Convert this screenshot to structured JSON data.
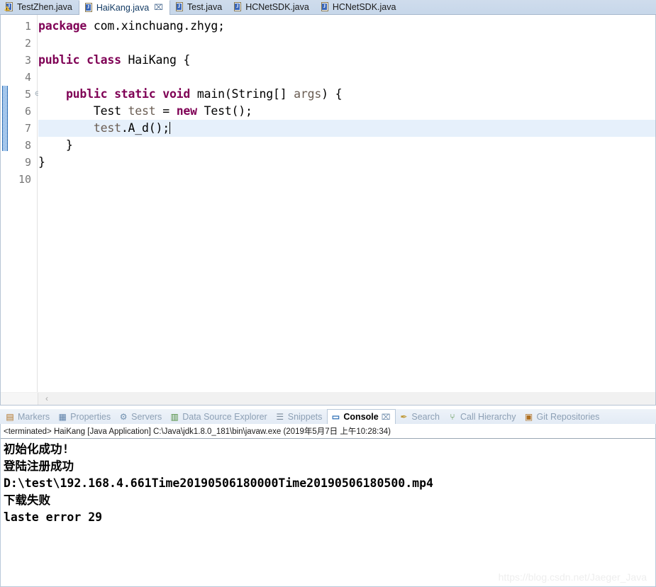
{
  "editor": {
    "tabs": [
      {
        "label": "TestZhen.java",
        "icon": "java-file-warning-icon",
        "active": false,
        "closable": false
      },
      {
        "label": "HaiKang.java",
        "icon": "java-file-icon",
        "active": true,
        "closable": true,
        "close_glyph": "⌧"
      },
      {
        "label": "Test.java",
        "icon": "java-file-icon",
        "active": false,
        "closable": false
      },
      {
        "label": "HCNetSDK.java",
        "icon": "java-file-icon",
        "active": false,
        "closable": false
      },
      {
        "label": "HCNetSDK.java",
        "icon": "java-file-icon",
        "active": false,
        "closable": false
      }
    ],
    "java_badge": "J",
    "scrollbar": {
      "left_arrow": "‹"
    },
    "highlight_line": 7,
    "fold_marker": "⊖",
    "lines": [
      {
        "number": "1",
        "fold": false,
        "tokens": [
          {
            "t": "package",
            "c": "kw"
          },
          {
            "t": " com.xinchuang.zhyg;",
            "c": "plain"
          }
        ]
      },
      {
        "number": "2",
        "fold": false,
        "tokens": [
          {
            "t": "",
            "c": "plain"
          }
        ]
      },
      {
        "number": "3",
        "fold": false,
        "tokens": [
          {
            "t": "public class",
            "c": "kw"
          },
          {
            "t": " HaiKang {",
            "c": "plain"
          }
        ]
      },
      {
        "number": "4",
        "fold": false,
        "tokens": [
          {
            "t": "",
            "c": "plain"
          }
        ]
      },
      {
        "number": "5",
        "fold": true,
        "tokens": [
          {
            "t": "    ",
            "c": "plain"
          },
          {
            "t": "public static void",
            "c": "kw"
          },
          {
            "t": " main(String[] ",
            "c": "plain"
          },
          {
            "t": "args",
            "c": "id"
          },
          {
            "t": ") {",
            "c": "plain"
          }
        ]
      },
      {
        "number": "6",
        "fold": false,
        "tokens": [
          {
            "t": "        Test ",
            "c": "plain"
          },
          {
            "t": "test",
            "c": "id"
          },
          {
            "t": " = ",
            "c": "plain"
          },
          {
            "t": "new",
            "c": "kw"
          },
          {
            "t": " Test();",
            "c": "plain"
          }
        ]
      },
      {
        "number": "7",
        "fold": false,
        "caret": true,
        "tokens": [
          {
            "t": "        ",
            "c": "plain"
          },
          {
            "t": "test",
            "c": "id"
          },
          {
            "t": ".A_d();",
            "c": "plain"
          }
        ]
      },
      {
        "number": "8",
        "fold": false,
        "tokens": [
          {
            "t": "    }",
            "c": "plain"
          }
        ]
      },
      {
        "number": "9",
        "fold": false,
        "tokens": [
          {
            "t": "}",
            "c": "plain"
          }
        ]
      },
      {
        "number": "10",
        "fold": false,
        "tokens": [
          {
            "t": "",
            "c": "plain"
          }
        ]
      }
    ]
  },
  "bottom_views": {
    "tabs": [
      {
        "label": "Markers",
        "icon": "markers-icon",
        "active": false
      },
      {
        "label": "Properties",
        "icon": "properties-icon",
        "active": false
      },
      {
        "label": "Servers",
        "icon": "servers-icon",
        "active": false
      },
      {
        "label": "Data Source Explorer",
        "icon": "data-source-explorer-icon",
        "active": false
      },
      {
        "label": "Snippets",
        "icon": "snippets-icon",
        "active": false
      },
      {
        "label": "Console",
        "icon": "console-icon",
        "active": true,
        "close_glyph": "⌧"
      },
      {
        "label": "Search",
        "icon": "search-icon",
        "active": false
      },
      {
        "label": "Call Hierarchy",
        "icon": "call-hierarchy-icon",
        "active": false
      },
      {
        "label": "Git Repositories",
        "icon": "git-repositories-icon",
        "active": false
      }
    ]
  },
  "console": {
    "launch_line": "<terminated> HaiKang [Java Application] C:\\Java\\jdk1.8.0_181\\bin\\javaw.exe (2019年5月7日 上午10:28:34)",
    "output_lines": [
      "初始化成功!",
      "登陆注册成功",
      "D:\\test\\192.168.4.661Time20190506180000Time20190506180500.mp4",
      "下载失败",
      "laste error 29"
    ]
  },
  "watermark": {
    "text": "https://blog.csdn.net/Jaeger_Java"
  },
  "colors": {
    "keyword": "#7f0055",
    "identifier": "#6a5d53",
    "line_highlight": "#e6f0fb",
    "tabbar": "#c7d7ea",
    "change_bar": "#4a8ed8"
  }
}
